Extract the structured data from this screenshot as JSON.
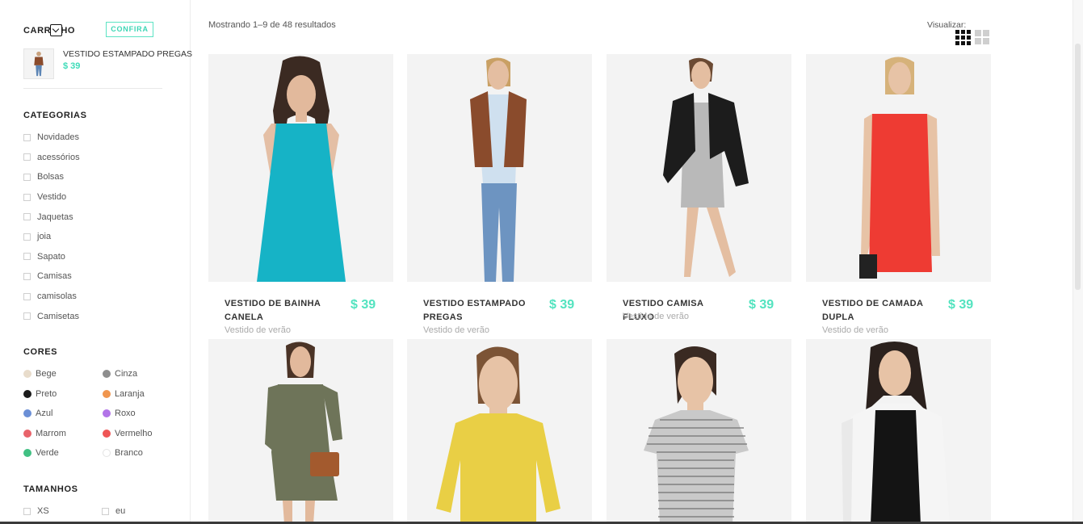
{
  "cart": {
    "title": "CARRINHO",
    "cta_label": "CONFIRA",
    "item": {
      "name": "VESTIDO ESTAMPADO PREGAS",
      "price": "$ 39"
    }
  },
  "categories": {
    "title": "CATEGORIAS",
    "items": [
      "Novidades",
      "acessórios",
      "Bolsas",
      "Vestido",
      "Jaquetas",
      "joia",
      "Sapato",
      "Camisas",
      "camisolas",
      "Camisetas"
    ]
  },
  "colors": {
    "title": "CORES",
    "items": [
      {
        "label": "Bege",
        "hex": "#e8dccb"
      },
      {
        "label": "Cinza",
        "hex": "#8e8e8e"
      },
      {
        "label": "Preto",
        "hex": "#1b1b1b"
      },
      {
        "label": "Laranja",
        "hex": "#f0964f"
      },
      {
        "label": "Azul",
        "hex": "#6b8fd6"
      },
      {
        "label": "Roxo",
        "hex": "#b274e8"
      },
      {
        "label": "Marrom",
        "hex": "#e8636a"
      },
      {
        "label": "Vermelho",
        "hex": "#ef5656"
      },
      {
        "label": "Verde",
        "hex": "#41c083"
      },
      {
        "label": "Branco",
        "hex": "#ffffff"
      }
    ]
  },
  "sizes": {
    "title": "TAMANHOS",
    "items": [
      "XS",
      "eu"
    ]
  },
  "results": {
    "text": "Mostrando 1–9 de 48 resultados"
  },
  "view": {
    "label": "Visualizar:"
  },
  "products": [
    {
      "name": "VESTIDO DE BAINHA CANELA",
      "price": "$ 39",
      "subtitle": "Vestido de verão",
      "garment_color": "#16b3c6"
    },
    {
      "name": "VESTIDO ESTAMPADO PREGAS",
      "price": "$ 39",
      "subtitle": "Vestido de verão",
      "garment_color": "#8a4b2c"
    },
    {
      "name": "VESTIDO CAMISA FLUXO",
      "price": "$ 39",
      "subtitle": "Vestido de verão",
      "garment_color": "#1c1c1c"
    },
    {
      "name": "VESTIDO DE CAMADA DUPLA",
      "price": "$ 39",
      "subtitle": "Vestido de verão",
      "garment_color": "#ee3b33"
    },
    {
      "garment_color": "#6e7459"
    },
    {
      "garment_color": "#e9cf45"
    },
    {
      "garment_color": "#c9c9c9"
    },
    {
      "garment_color": "#f5f5f5"
    }
  ]
}
